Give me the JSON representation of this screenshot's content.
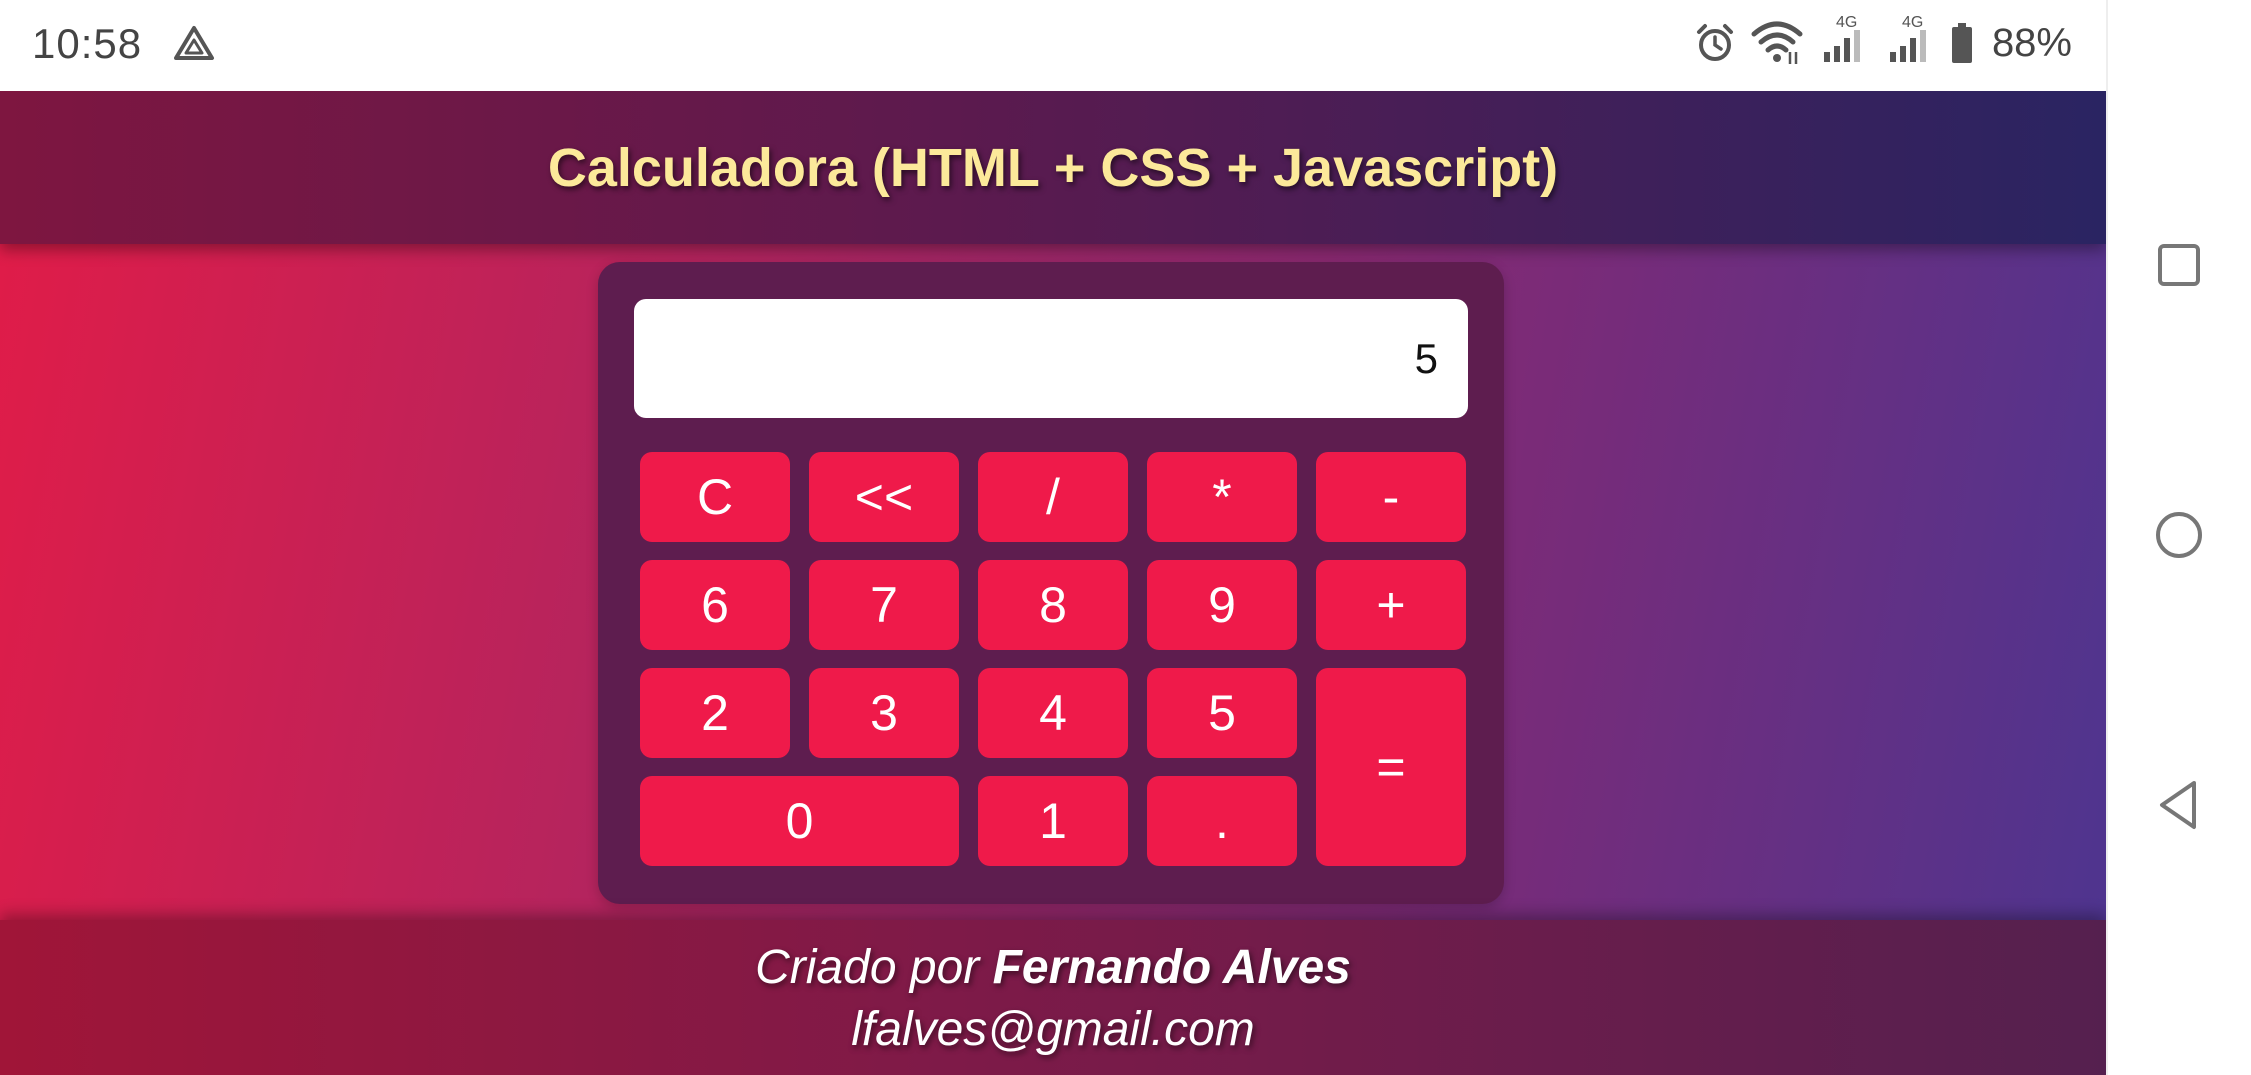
{
  "status_bar": {
    "time": "10:58",
    "app_icon": "drive-triangle-icon",
    "icons": [
      "alarm-icon",
      "wifi-icon",
      "signal-4g-icon",
      "signal-4g-icon",
      "battery-icon"
    ],
    "network_labels": [
      "4G",
      "4G"
    ],
    "battery_text": "88%"
  },
  "header": {
    "title": "Calculadora (HTML + CSS + Javascript)"
  },
  "calculator": {
    "display_value": "5",
    "keys": {
      "clear": "C",
      "backspace": "<<",
      "divide": "/",
      "multiply": "*",
      "subtract": "-",
      "six": "6",
      "seven": "7",
      "eight": "8",
      "nine": "9",
      "add": "+",
      "two": "2",
      "three": "3",
      "four": "4",
      "five": "5",
      "equals": "=",
      "zero": "0",
      "one": "1",
      "decimal": "."
    }
  },
  "footer": {
    "created_by_prefix": "Criado por ",
    "author": "Fernando Alves",
    "email": "lfalves@gmail.com"
  },
  "nav_bar": {
    "buttons": [
      "recents-square-icon",
      "home-circle-icon",
      "back-triangle-icon"
    ]
  },
  "colors": {
    "key_bg": "#ef1a4a",
    "calc_bg": "#5e1d4f",
    "title_color": "#fce99a"
  }
}
